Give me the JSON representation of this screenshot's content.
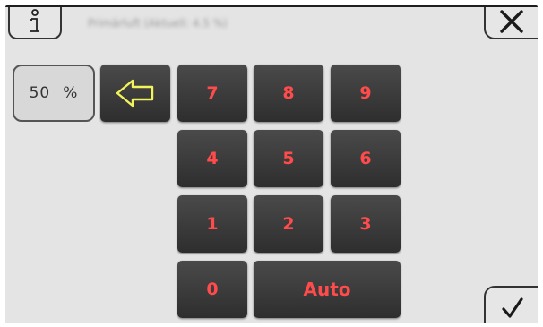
{
  "header": {
    "title": "Primärluft (Aktuell: 4.5 %)"
  },
  "value_display": {
    "value": "50",
    "unit": "%"
  },
  "keypad": {
    "keys": [
      "7",
      "8",
      "9",
      "4",
      "5",
      "6",
      "1",
      "2",
      "3",
      "0"
    ],
    "auto_label": "Auto"
  },
  "icons": {
    "info": "info-icon",
    "close": "close-icon",
    "backspace": "arrow-left-icon",
    "confirm": "checkmark-icon"
  },
  "colors": {
    "key_text": "#ff4b4b",
    "backspace_arrow": "#f2f25a",
    "key_bg": "#3a3a3a"
  }
}
